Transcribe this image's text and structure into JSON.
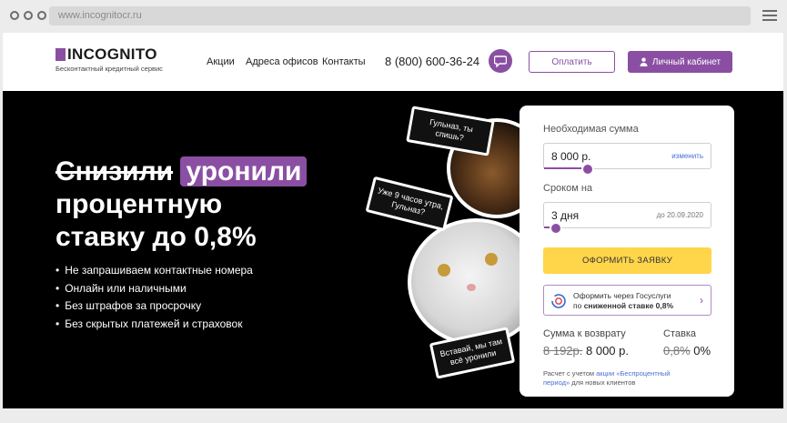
{
  "browser": {
    "url": "www.incognitocr.ru"
  },
  "header": {
    "logo_text": "INCOGNITO",
    "logo_sub": "Бесконтактный кредитный сервис",
    "nav": [
      "Акции",
      "Адреса офисов",
      "Контакты"
    ],
    "phone": "8 (800) 600-36-24",
    "pay_label": "Оплатить",
    "cabinet_label": "Личный кабинет",
    "accent": "#8a4fa3"
  },
  "hero": {
    "headline_strike": "Снизили",
    "headline_highlight": "уронили",
    "headline_line2": "процентную",
    "headline_line3": "ставку до 0,8%",
    "bullets": [
      "Не запрашиваем контактные номера",
      "Онлайн или наличными",
      "Без штрафов за просрочку",
      "Без скрытых платежей и страховок"
    ],
    "bubbles": [
      "Гульназ, ты спишь?",
      "Уже 9 часов утра, Гульназ?",
      "Вставай, мы там всё уронили"
    ]
  },
  "calculator": {
    "amount_label": "Необходимая сумма",
    "amount_value": "8 000 р.",
    "amount_link": "изменить",
    "amount_slider": 0.26,
    "term_label": "Сроком на",
    "term_value": "3 дня",
    "term_until": "до 20.09.2020",
    "term_slider": 0.07,
    "apply_label": "ОФОРМИТЬ ЗАЯВКУ",
    "gos_line1": "Оформить через Госуслуги",
    "gos_line2_pre": "по ",
    "gos_line2_bold": "сниженной ставке 0,8%",
    "return_label": "Сумма к возврату",
    "return_old": "8 192р.",
    "return_new": "8 000 р.",
    "rate_label": "Ставка",
    "rate_old": "0,8%",
    "rate_new": "0%",
    "note_pre": "Расчет с учетом ",
    "note_link": "акции «Беспроцентный период»",
    "note_post": " для новых клиентов",
    "button_color": "#ffd54a"
  }
}
